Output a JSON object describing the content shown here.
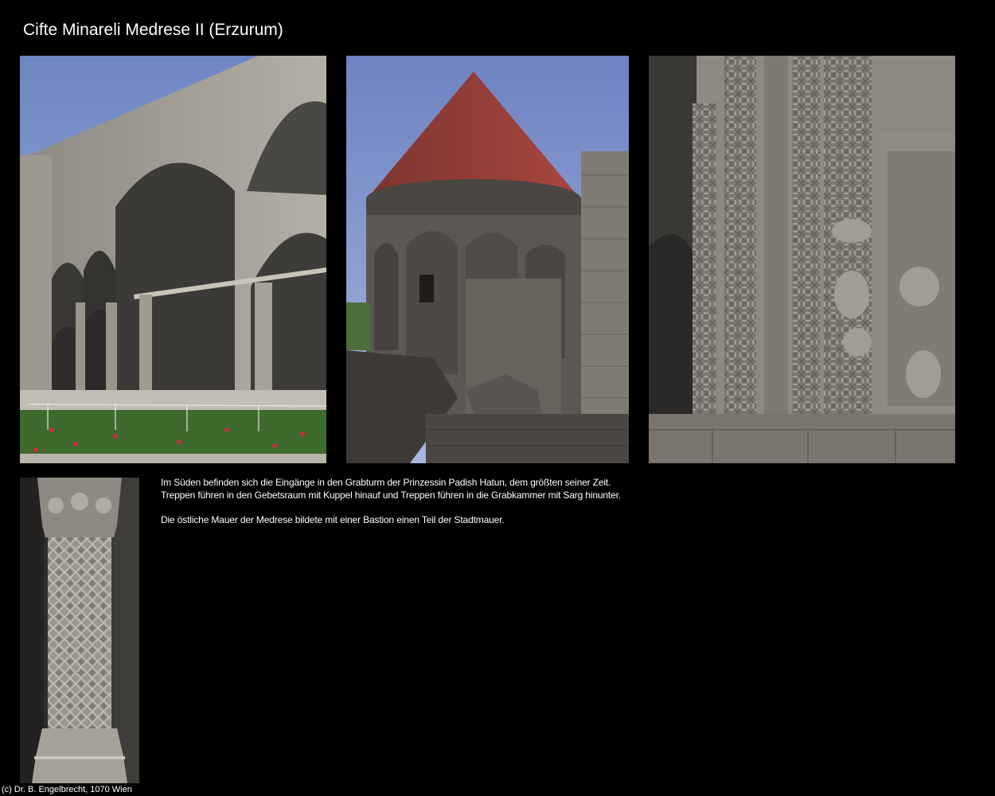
{
  "page": {
    "title": "Cifte Minareli Medrese II (Erzurum)"
  },
  "photos": [
    {
      "id": "courtyard-arcade",
      "description": ""
    },
    {
      "id": "tomb-tower",
      "description": ""
    },
    {
      "id": "carved-portal",
      "description": ""
    },
    {
      "id": "carved-column",
      "description": ""
    }
  ],
  "text": {
    "paragraph_1_line_1": "Im Süden befinden sich die Eingänge in den Grabturm der Prinzessin Padish Hatun, dem größten seiner Zeit.",
    "paragraph_1_line_2": "Treppen führen in den Gebetsraum mit Kuppel hinauf und Treppen führen in die Grabkammer mit Sarg hinunter.",
    "paragraph_2": "Die östliche Mauer der Medrese bildete mit einer Bastion einen Teil der Stadtmauer."
  },
  "footer": {
    "copyright": "(c) Dr. B. Engelbrecht, 1070 Wien"
  },
  "colors": {
    "background": "#000000",
    "text": "#ffffff"
  }
}
